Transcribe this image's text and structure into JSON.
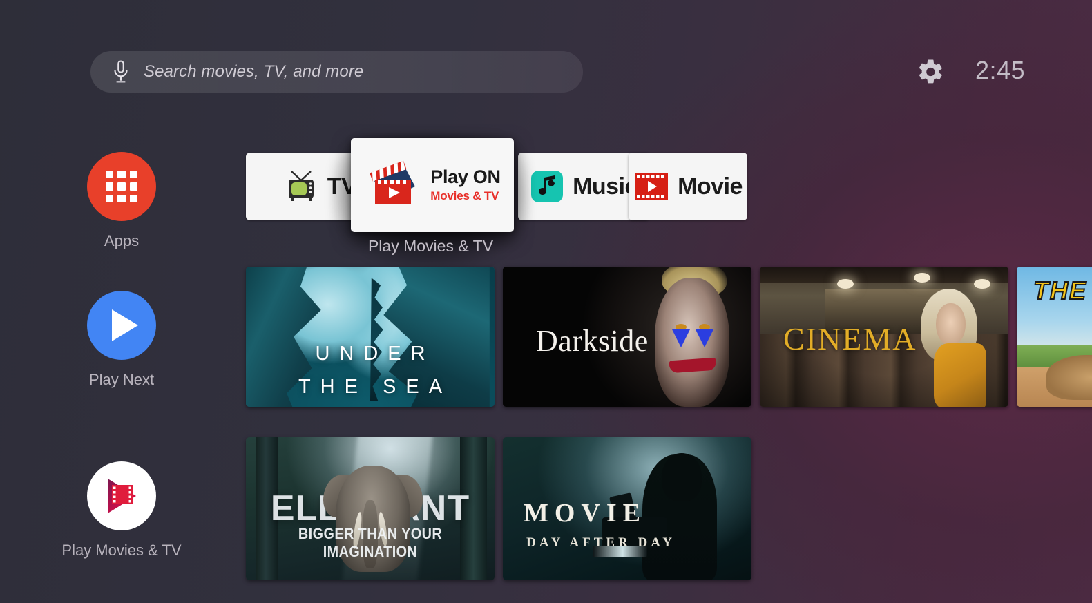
{
  "topbar": {
    "search": {
      "placeholder": "Search movies, TV, and more",
      "value": "",
      "mic_icon": "microphone-icon"
    },
    "settings_icon": "gear-icon",
    "clock": "2:45"
  },
  "sidebar": {
    "items": [
      {
        "label": "Apps",
        "icon": "apps-grid-icon",
        "color": "#E8402A"
      },
      {
        "label": "Play Next",
        "icon": "play-triangle-icon",
        "color": "#4285F4"
      },
      {
        "label": "Play Movies & TV",
        "icon": "play-movies-logo-icon",
        "color": "#FFFFFF"
      }
    ]
  },
  "app_row": {
    "focused_label": "Play Movies & TV",
    "cards": [
      {
        "name": "tv",
        "label": "TV",
        "icon": "retro-tv-icon"
      },
      {
        "name": "play-on",
        "label": "Play ON",
        "sublabel": "Movies & TV",
        "icon": "clapperboard-icon",
        "focused": true
      },
      {
        "name": "music",
        "label": "Music",
        "icon": "music-note-icon"
      },
      {
        "name": "movie",
        "label": "Movie",
        "icon": "film-strip-play-icon"
      }
    ]
  },
  "content": {
    "rows": [
      {
        "cards": [
          {
            "name": "under-the-sea",
            "title_line1": "UNDER",
            "title_line2": "THE SEA"
          },
          {
            "name": "darkside",
            "title": "Darkside"
          },
          {
            "name": "cinema",
            "title": "CINEMA"
          },
          {
            "name": "the-partial",
            "title": "THE"
          }
        ]
      },
      {
        "cards": [
          {
            "name": "elephant",
            "title": "ELEPHANT",
            "subtitle": "BIGGER THAN YOUR IMAGINATION"
          },
          {
            "name": "movie-day-after-day",
            "title": "MOVIE",
            "subtitle": "DAY AFTER DAY"
          }
        ]
      }
    ]
  },
  "colors": {
    "accent_red": "#E8402A",
    "accent_blue": "#4285F4",
    "card_bg": "#F5F5F5",
    "text_muted": "#B9B4BD",
    "playon_sub_red": "#E8302A",
    "cinema_gold": "#E2AD27"
  }
}
